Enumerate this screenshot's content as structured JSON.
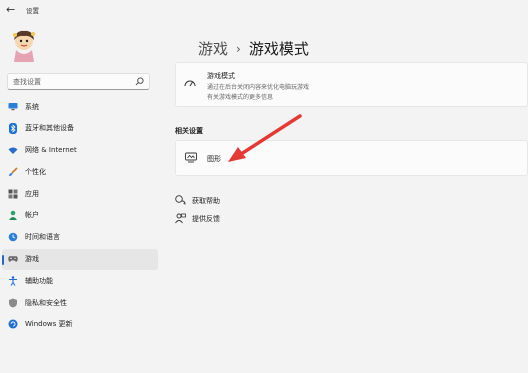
{
  "window": {
    "title": "设置"
  },
  "search": {
    "placeholder": "查找设置"
  },
  "sidebar": {
    "items": [
      {
        "label": "系统",
        "icon": "monitor-icon",
        "active": false
      },
      {
        "label": "蓝牙和其他设备",
        "icon": "bluetooth-icon",
        "active": false
      },
      {
        "label": "网络 & Internet",
        "icon": "wifi-icon",
        "active": false
      },
      {
        "label": "个性化",
        "icon": "brush-icon",
        "active": false
      },
      {
        "label": "应用",
        "icon": "apps-icon",
        "active": false
      },
      {
        "label": "帐户",
        "icon": "person-icon",
        "active": false
      },
      {
        "label": "时间和语言",
        "icon": "clock-globe-icon",
        "active": false
      },
      {
        "label": "游戏",
        "icon": "gamepad-icon",
        "active": true
      },
      {
        "label": "辅助功能",
        "icon": "accessibility-icon",
        "active": false
      },
      {
        "label": "隐私和安全性",
        "icon": "shield-icon",
        "active": false
      },
      {
        "label": "Windows 更新",
        "icon": "windows-update-icon",
        "active": false
      }
    ]
  },
  "breadcrumb": {
    "parent": "游戏",
    "separator": "›",
    "current": "游戏模式"
  },
  "game_mode": {
    "title": "游戏模式",
    "description_line1": "通过在后台关闭内容来优化电脑玩游戏",
    "description_line2": "有关游戏模式的更多信息"
  },
  "related": {
    "title": "相关设置",
    "graphics_label": "图形"
  },
  "links": {
    "help": "获取帮助",
    "feedback": "提供反馈"
  },
  "colors": {
    "accent": "#2a63d6",
    "arrow": "#e53935",
    "active_bg": "#e6e6e6"
  }
}
